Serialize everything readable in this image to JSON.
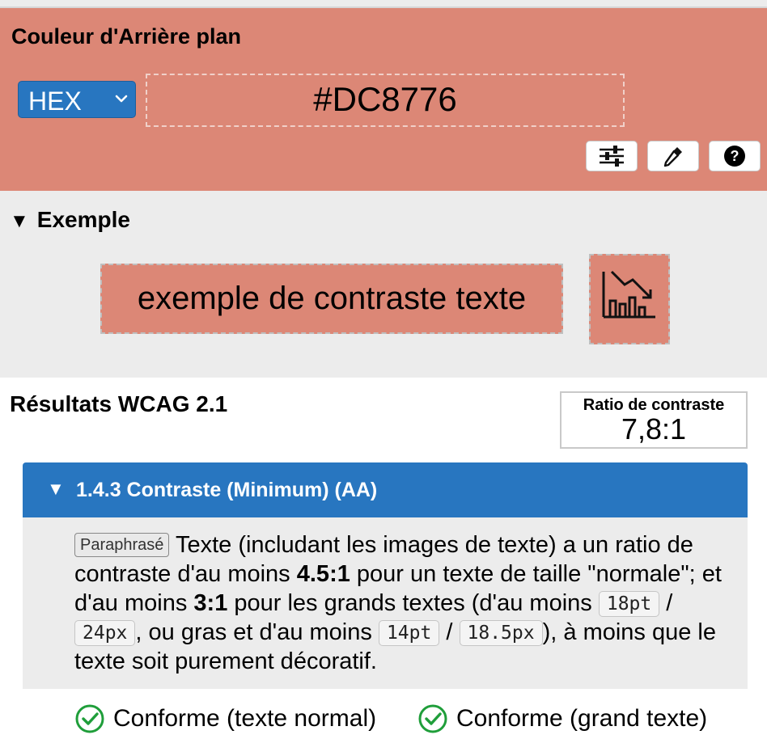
{
  "background_panel": {
    "title": "Couleur d'Arrière plan",
    "color": "#DC8776",
    "format_select": {
      "value": "HEX"
    },
    "hex_value": "#DC8776",
    "tools": [
      "sliders-icon",
      "eyedropper-icon",
      "help-icon"
    ]
  },
  "example": {
    "heading": "Exemple",
    "sample_text": "exemple de contraste texte",
    "sample_icon": "declining-chart-icon"
  },
  "results": {
    "title": "Résultats WCAG 2.1",
    "ratio_label": "Ratio de contraste",
    "ratio_value": "7,8:1",
    "criterion": {
      "title": "1.4.3 Contraste (Minimum) (AA)",
      "tag": "Paraphrasé",
      "text_1": "Texte (includant les images de texte) a un ratio de contraste d'au moins",
      "ratio_normal": "4.5:1",
      "text_2": "pour un texte de taille \"normale\"; et d'au moins",
      "ratio_large": "3:1",
      "text_3": "pour les grands textes (d'au moins",
      "size_1": "18pt",
      "sep_1": "/",
      "size_2": "24px",
      "text_4": ", ou gras et d'au moins",
      "size_3": "14pt",
      "sep_2": "/",
      "size_4": "18.5px",
      "text_5": "), à moins que le texte soit purement décoratif."
    },
    "pass_normal": "Conforme (texte normal)",
    "pass_large": "Conforme (grand texte)",
    "pass_color": "#1f9e3a",
    "accent_color": "#2876c0"
  }
}
